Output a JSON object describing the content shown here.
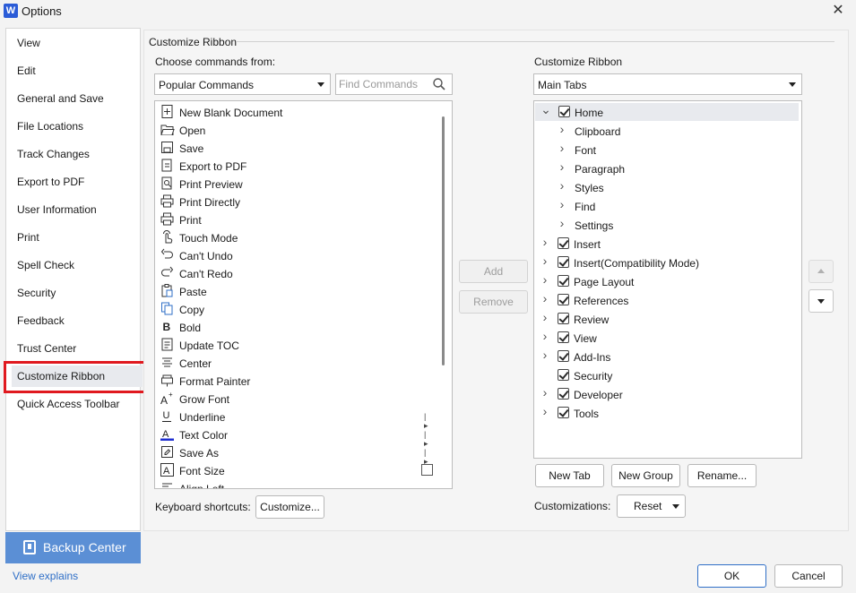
{
  "window": {
    "app_icon": "W",
    "title": "Options",
    "close_glyph": "✕"
  },
  "sidebar": {
    "items": [
      {
        "label": "View"
      },
      {
        "label": "Edit"
      },
      {
        "label": "General and Save"
      },
      {
        "label": "File Locations"
      },
      {
        "label": "Track Changes"
      },
      {
        "label": "Export to PDF"
      },
      {
        "label": "User Information"
      },
      {
        "label": "Print"
      },
      {
        "label": "Spell Check"
      },
      {
        "label": "Security"
      },
      {
        "label": "Feedback"
      },
      {
        "label": "Trust Center"
      },
      {
        "label": "Customize Ribbon",
        "selected": true
      },
      {
        "label": "Quick Access Toolbar"
      }
    ],
    "backup_label": "Backup Center",
    "view_explains": "View explains"
  },
  "customize": {
    "group_title": "Customize Ribbon",
    "choose_label": "Choose commands from:",
    "choose_value": "Popular Commands",
    "find_placeholder": "Find Commands",
    "commands": [
      {
        "label": "New Blank Document",
        "icon": "new-document-icon"
      },
      {
        "label": "Open",
        "icon": "open-folder-icon"
      },
      {
        "label": "Save",
        "icon": "save-icon"
      },
      {
        "label": "Export to PDF",
        "icon": "export-pdf-icon"
      },
      {
        "label": "Print Preview",
        "icon": "print-preview-icon"
      },
      {
        "label": "Print  Directly",
        "icon": "print-directly-icon"
      },
      {
        "label": "Print",
        "icon": "printer-icon"
      },
      {
        "label": "Touch Mode",
        "icon": "touch-hand-icon"
      },
      {
        "label": "Can't Undo",
        "icon": "undo-icon"
      },
      {
        "label": "Can't Redo",
        "icon": "redo-icon"
      },
      {
        "label": "Paste",
        "icon": "paste-icon"
      },
      {
        "label": "Copy",
        "icon": "copy-icon"
      },
      {
        "label": "Bold",
        "icon": "bold-icon"
      },
      {
        "label": "Update  TOC",
        "icon": "update-toc-icon"
      },
      {
        "label": "Center",
        "icon": "align-center-icon"
      },
      {
        "label": "Format  Painter",
        "icon": "format-painter-icon"
      },
      {
        "label": "Grow Font",
        "icon": "grow-font-icon"
      },
      {
        "label": "Underline",
        "icon": "underline-icon",
        "submenu": true
      },
      {
        "label": "Text Color",
        "icon": "text-color-icon",
        "submenu": true
      },
      {
        "label": "Save As",
        "icon": "save-as-icon",
        "submenu": true
      },
      {
        "label": "Font Size",
        "icon": "font-size-icon",
        "dropdown": true
      },
      {
        "label": "Align Left",
        "icon": "align-left-icon"
      }
    ],
    "add_label": "Add",
    "remove_label": "Remove",
    "ribbon_label": "Customize Ribbon",
    "ribbon_value": "Main Tabs",
    "tree": [
      {
        "label": "Home",
        "level": 0,
        "expanded": true,
        "checkbox": true,
        "checked": true,
        "selected": true
      },
      {
        "label": "Clipboard",
        "level": 1
      },
      {
        "label": "Font",
        "level": 1
      },
      {
        "label": "Paragraph",
        "level": 1
      },
      {
        "label": "Styles",
        "level": 1
      },
      {
        "label": "Find",
        "level": 1
      },
      {
        "label": "Settings",
        "level": 1
      },
      {
        "label": "Insert",
        "level": 0,
        "checkbox": true,
        "checked": true
      },
      {
        "label": "Insert(Compatibility Mode)",
        "level": 0,
        "checkbox": true,
        "checked": true
      },
      {
        "label": "Page Layout",
        "level": 0,
        "checkbox": true,
        "checked": true
      },
      {
        "label": "References",
        "level": 0,
        "checkbox": true,
        "checked": true
      },
      {
        "label": "Review",
        "level": 0,
        "checkbox": true,
        "checked": true
      },
      {
        "label": "View",
        "level": 0,
        "checkbox": true,
        "checked": true
      },
      {
        "label": "Add-Ins",
        "level": 0,
        "checkbox": true,
        "checked": true
      },
      {
        "label": "Security",
        "level": 0,
        "checkbox": true,
        "checked": true,
        "no_chevron": true
      },
      {
        "label": "Developer",
        "level": 0,
        "checkbox": true,
        "checked": true
      },
      {
        "label": "Tools",
        "level": 0,
        "checkbox": true,
        "checked": true
      }
    ],
    "new_tab_label": "New Tab",
    "new_group_label": "New Group",
    "rename_label": "Rename...",
    "customizations_label": "Customizations:",
    "reset_label": "Reset",
    "keyboard_label": "Keyboard shortcuts:",
    "customize_label": "Customize..."
  },
  "footer": {
    "ok_label": "OK",
    "cancel_label": "Cancel"
  },
  "colors": {
    "accent": "#2f6fc7",
    "backup_bg": "#5b8fd5",
    "highlight_box": "#e0191f",
    "text_color_bar": "#1f2fd0"
  }
}
